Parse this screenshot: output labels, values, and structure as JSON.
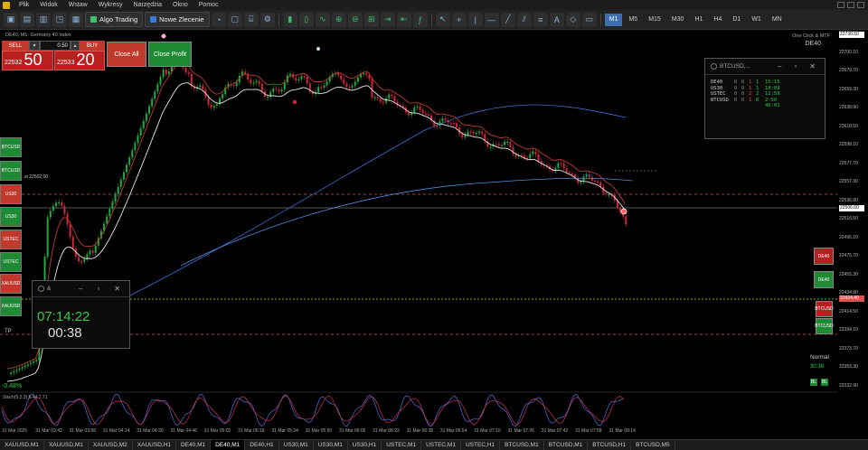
{
  "menu": {
    "items": [
      "Plik",
      "Widok",
      "Wstaw",
      "Wykresy",
      "Narzędzia",
      "Okno",
      "Pomoc"
    ]
  },
  "toolbar": {
    "algo_label": "Algo Trading",
    "new_order_label": "Nowe Zlecenie",
    "timeframes": [
      "M1",
      "M5",
      "M15",
      "M30",
      "H1",
      "H4",
      "D1",
      "W1",
      "MN"
    ],
    "active_timeframe": "M1"
  },
  "chart": {
    "title": "DE40, M1:  Germany 40 Index",
    "one_click": "One Click & MTF",
    "symbol": "DE40",
    "line_label": "st 22502.00",
    "price_ticks": [
      "22720.50",
      "22700.10",
      "22679.70",
      "22659.30",
      "22638.90",
      "22618.50",
      "22598.10",
      "22577.70",
      "22557.30",
      "22536.90",
      "22516.50",
      "22496.10",
      "22475.70",
      "22455.30",
      "22434.90",
      "22414.50",
      "22394.10",
      "22373.70",
      "22353.30",
      "22332.90"
    ],
    "price_tags": {
      "current": "22506.60",
      "red": "22424.40",
      "top": "22730.50"
    },
    "time_ticks": [
      "31 Mar 2025",
      "31 Mar 03:42",
      "31 Mar 03:58",
      "31 Mar 04:14",
      "31 Mar 04:30",
      "31 Mar 04:46",
      "31 Mar 05:02",
      "31 Mar 05:18",
      "31 Mar 05:34",
      "31 Mar 05:50",
      "31 Mar 06:06",
      "31 Mar 06:22",
      "31 Mar 06:38",
      "31 Mar 06:54",
      "31 Mar 07:10",
      "31 Mar 07:26",
      "31 Mar 07:42",
      "31 Mar 07:58",
      "31 Mar 08:14"
    ],
    "stoch_label": "Stoch(5,3,3) 6.44 7.71",
    "pct_label": "-0.48%",
    "tp_label": "TP"
  },
  "trade_panel": {
    "sell_label": "SELL",
    "buy_label": "BUY",
    "lot": "0.50",
    "sell_price_small": "22532",
    "sell_price_big": "50",
    "buy_price_small": "22533",
    "buy_price_big": "20",
    "close_all": "Close All",
    "close_profit": "Close Profit"
  },
  "side_buttons": [
    "BTCUSD",
    "BTCUSD",
    "US30",
    "US30",
    "USTEC",
    "USTEC",
    "XAUUSD",
    "XAUUSD"
  ],
  "right_buttons": [
    "DE40",
    "DE40",
    "BTCUSD",
    "BTCUSD"
  ],
  "info_window": {
    "title": "BTCUSD,...",
    "rows": [
      {
        "sym": "DE40",
        "a": "0",
        "b": "0",
        "c": "1",
        "d": "1",
        "time": "15:15"
      },
      {
        "sym": "US30",
        "a": "0",
        "b": "0",
        "c": "1",
        "d": "1",
        "time": "18:09"
      },
      {
        "sym": "USTEC",
        "a": "0",
        "b": "0",
        "c": "2",
        "d": "2",
        "time": "11:59"
      },
      {
        "sym": "BTCUSD",
        "a": "0",
        "b": "0",
        "c": "1",
        "d": "0",
        "time": "2:50"
      }
    ],
    "extra": "46:01"
  },
  "clock_window": {
    "title": "&",
    "time": "07:14:22",
    "countdown": "00:38"
  },
  "status": {
    "normal_label": "Normal",
    "normal_value": "30:38",
    "sq1": "BL",
    "sq2": "BL"
  },
  "tabs": [
    "XAUUSD,M1",
    "XAUUSD,M1",
    "XAUUSD,M2",
    "XAUUSD,H1",
    "DE40,M1",
    "DE40,M1",
    "DE40,H1",
    "US30,M1",
    "US30,M1",
    "US30,H1",
    "USTEC,M1",
    "USTEC,M1",
    "USTEC,H1",
    "BTCUSD,M1",
    "BTCUSD,M1",
    "BTCUSD,H1",
    "BTCUSD,M5"
  ],
  "active_tab_index": 5,
  "colors": {
    "bull": "#1faa3f",
    "bear": "#d0253a",
    "ma_white": "#e6e6e6",
    "ma_red": "#c0392b",
    "ma_blue": "#3a6fd0",
    "ma_blue_light": "#4c8fe0"
  }
}
